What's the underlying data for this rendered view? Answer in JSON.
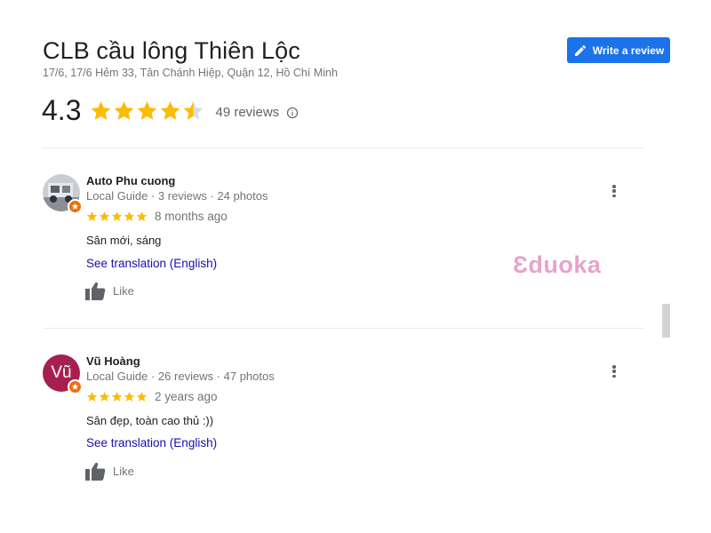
{
  "place": {
    "title": "CLB cầu lông Thiên Lộc",
    "address": "17/6, 17/6 Hẻm 33, Tân Chánh Hiệp, Quận 12, Hồ Chí Minh"
  },
  "toolbar": {
    "write_review_label": "Write a review",
    "write_review_icon": "pencil-icon"
  },
  "rating": {
    "value": "4.3",
    "stars": 4.3,
    "review_count_label": "49 reviews",
    "star_color": "#fbbc04"
  },
  "reviews": [
    {
      "name": "Auto Phu cuong",
      "meta": "Local Guide · 3 reviews · 24 photos",
      "stars": 5,
      "date": "8 months ago",
      "text": "Sân mới, sáng",
      "translate_label": "See translation (English)",
      "like_label": "Like",
      "avatar_type": "photo"
    },
    {
      "name": "Vũ Hoàng",
      "meta": "Local Guide · 26 reviews · 47 photos",
      "stars": 5,
      "date": "2 years ago",
      "text": "Sân đẹp, toàn cao thủ :))",
      "translate_label": "See translation (English)",
      "like_label": "Like",
      "avatar_letter": "Vũ",
      "avatar_color": "#a52050"
    }
  ],
  "watermark": "Ɛduoka",
  "colors": {
    "accent": "#1a73e8",
    "link": "#1a0dab",
    "local_guide_badge": "#e8710a"
  }
}
